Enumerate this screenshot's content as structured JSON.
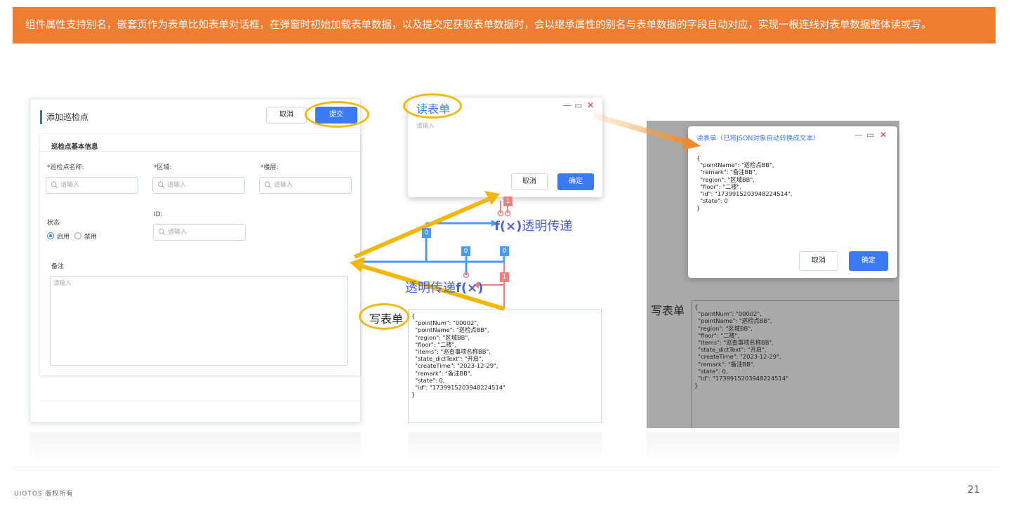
{
  "banner": {
    "text": "组件属性支持别名，嵌套页作为表单比如表单对话框，在弹窗时初始加载表单数据，以及提交定获取表单数据时，会以继承属性的别名与表单数据的字段自动对应，实现一根连线对表单数据整体读或写。",
    "bg_color": "#ee7d31"
  },
  "form": {
    "title": "添加巡检点",
    "cancel_label": "取消",
    "submit_label": "提交",
    "section_title": "巡检点基本信息",
    "fields": {
      "name_label": "*巡检点名称:",
      "region_label": "*区域:",
      "floor_label": "*楼层:",
      "status_label": "状态",
      "id_label": "ID:",
      "remark_label": "备注",
      "placeholder": "请输入"
    },
    "status_options": [
      "启用",
      "禁用"
    ],
    "status_selected": "启用"
  },
  "read_dialog": {
    "title": "读表单",
    "placeholder": "请输入",
    "cancel_label": "取消",
    "ok_label": "确定"
  },
  "read_result_dialog": {
    "title": "读表单（已将JSON对象自动转换成文本）",
    "json_text": "{\n  \"pointName\": \"巡检点BB\",\n  \"remark\": \"备注BB\",\n  \"region\": \"区域BB\",\n  \"floor\": \"二楼\",\n  \"id\": \"1739915203948224514\",\n  \"state\": 0\n}",
    "cancel_label": "取消",
    "ok_label": "确定"
  },
  "write_form": {
    "label": "写表单",
    "json_text": "{\n  \"pointNum\": \"00002\",\n  \"pointName\": \"巡检点BB\",\n  \"region\": \"区域BB\",\n  \"floor\": \"二楼\",\n  \"items\": \"巡查事项名称BB\",\n  \"state_dictText\": \"开启\",\n  \"createTime\": \"2023-12-29\",\n  \"remark\": \"备注BB\",\n  \"state\": 0,\n  \"id\": \"1739915203948224514\"\n}"
  },
  "flow": {
    "transparent_pass_top": "透明传递",
    "transparent_pass_bottom": "透明传递",
    "fx": "f(×)",
    "node_values": [
      "0",
      "0",
      "0",
      "1",
      "1"
    ]
  },
  "colors": {
    "accent": "#3a7bf5",
    "highlight": "#f5b90d",
    "arrow": "#f0b80a",
    "link_blue": "#4a9cf0",
    "link_red": "#f08080"
  },
  "footer": {
    "copyright": "UIOTOS 版权所有",
    "page_number": "21"
  }
}
